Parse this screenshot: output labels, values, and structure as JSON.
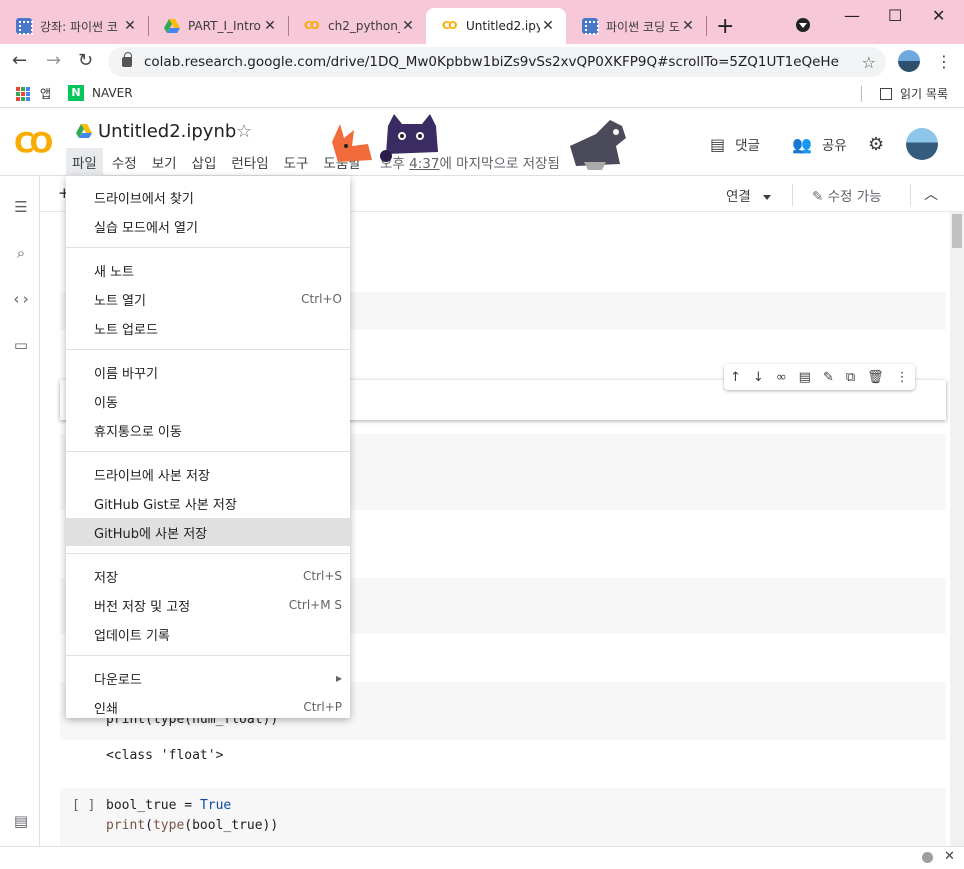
{
  "browser": {
    "tabs": [
      {
        "title": "강좌: 파이썬 코",
        "favicon": "ebs-favicon",
        "active": false
      },
      {
        "title": "PART_I_Intro -",
        "favicon": "google-drive-favicon",
        "active": false
      },
      {
        "title": "ch2_python_b",
        "favicon": "colab-favicon",
        "active": false
      },
      {
        "title": "Untitled2.ipyn",
        "favicon": "colab-favicon",
        "active": true
      },
      {
        "title": "파이썬 코딩 도",
        "favicon": "ebs-favicon",
        "active": false
      }
    ],
    "url": "colab.research.google.com/drive/1DQ_Mw0Kpbbw1biZs9vSs2xvQP0XKFP9Q#scrollTo=5ZQ1UT1eQeHe",
    "bookmarks": {
      "apps": "앱",
      "naver": "NAVER",
      "naver_icon_letter": "N",
      "reading_list": "읽기 목록"
    }
  },
  "colab": {
    "logo": "CO",
    "notebook_title": "Untitled2.ipynb",
    "menu": [
      "파일",
      "수정",
      "보기",
      "삽입",
      "런타임",
      "도구",
      "도움말"
    ],
    "saved_prefix": "오후 ",
    "saved_time": "4:37",
    "saved_suffix": "에 마지막으로 저장됨",
    "comment_label": "댓글",
    "share_label": "공유",
    "connect_label": "연결",
    "edit_label": "수정 가능",
    "add_button_glyph": "+"
  },
  "file_menu": {
    "groups": [
      [
        {
          "label": "드라이브에서 찾기",
          "shortcut": ""
        },
        {
          "label": "실습 모드에서 열기",
          "shortcut": ""
        }
      ],
      [
        {
          "label": "새 노트",
          "shortcut": ""
        },
        {
          "label": "노트 열기",
          "shortcut": "Ctrl+O"
        },
        {
          "label": "노트 업로드",
          "shortcut": ""
        }
      ],
      [
        {
          "label": "이름 바꾸기",
          "shortcut": ""
        },
        {
          "label": "이동",
          "shortcut": ""
        },
        {
          "label": "휴지통으로 이동",
          "shortcut": ""
        }
      ],
      [
        {
          "label": "드라이브에 사본 저장",
          "shortcut": ""
        },
        {
          "label": "GitHub Gist로 사본 저장",
          "shortcut": ""
        },
        {
          "label": "GitHub에 사본 저장",
          "shortcut": "",
          "highlighted": true
        }
      ],
      [
        {
          "label": "저장",
          "shortcut": "Ctrl+S"
        },
        {
          "label": "버전 저장 및 고정",
          "shortcut": "Ctrl+M S"
        },
        {
          "label": "업데이트 기록",
          "shortcut": ""
        }
      ],
      [
        {
          "label": "다운로드",
          "shortcut": "▸"
        },
        {
          "label": "인쇄",
          "shortcut": "Ctrl+P"
        }
      ]
    ]
  },
  "cells": {
    "partial_code": "print(type(num_float))",
    "partial_output": "<class 'float'>",
    "bool_cell": {
      "run_marker": "[ ]",
      "line1_var": "bool_true",
      "line1_op": " = ",
      "line1_value": "True",
      "line2_fn": "print",
      "line2_open": "(",
      "line2_type": "type",
      "line2_rest": "(bool_true))"
    }
  },
  "colors": {
    "tabstrip": "#f6c8d8",
    "colab_orange": "#f9ab00",
    "keyword_blue": "#0d47a1",
    "menu_highlight": "#e0e0e0"
  }
}
